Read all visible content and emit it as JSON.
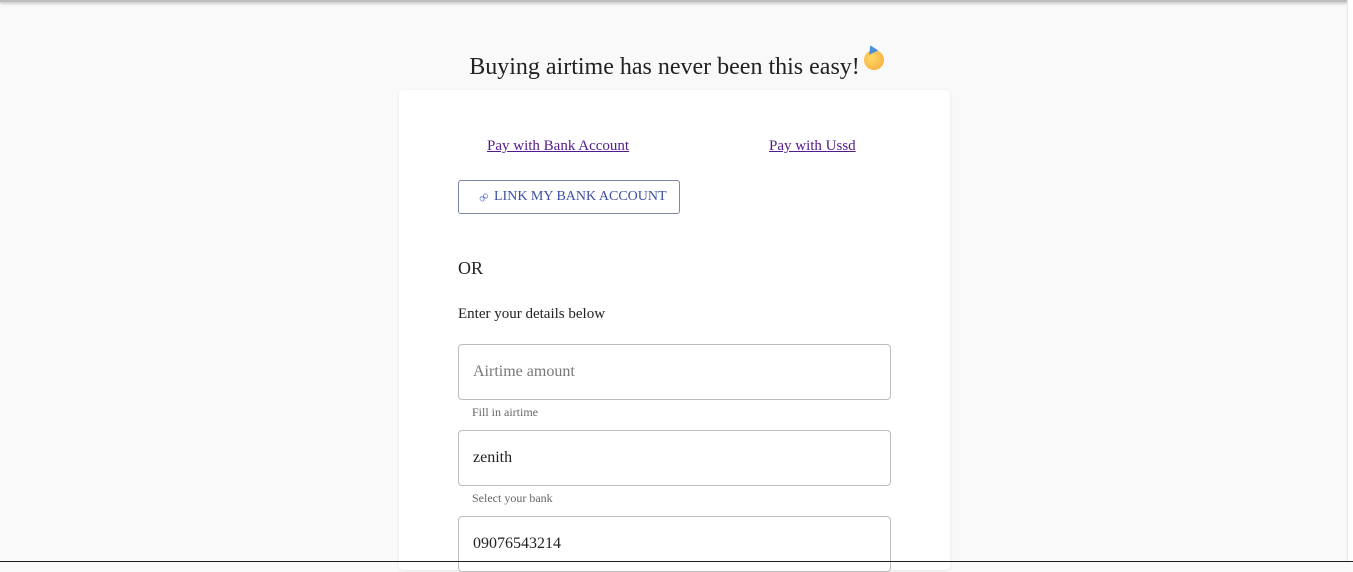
{
  "header": {
    "title": "Buying airtime has never been this easy!",
    "emoji_icon": "party-face-icon"
  },
  "tabs": {
    "bank": "Pay with Bank Account",
    "ussd": "Pay with Ussd"
  },
  "link_button": {
    "icon": "link-icon",
    "label": "LINK MY BANK ACCOUNT"
  },
  "or_label": "OR",
  "instructions": "Enter your details below",
  "form": {
    "airtime": {
      "value": "",
      "placeholder": "Airtime amount",
      "helper": "Fill in airtime"
    },
    "bank": {
      "value": "zenith",
      "helper": "Select your bank"
    },
    "phone": {
      "value": "09076543214"
    }
  },
  "colors": {
    "background": "#f9f9f9",
    "card": "#ffffff",
    "link": "#551a8b",
    "button_text": "#3c4fa3",
    "button_border": "#7d86a8"
  }
}
